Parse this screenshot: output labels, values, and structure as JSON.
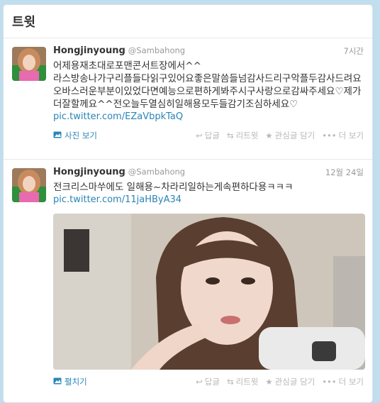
{
  "panel_title": "트윗",
  "tweets": [
    {
      "name": "Hongjinyoung",
      "handle": "@Sambahong",
      "time": "7시간",
      "lines": [
        "어제용재초대로포맨콘서트장에서^^",
        "라스방송나가구리플들다읽구있어요좋은말씀들넘감사드리구악플두감사드려요",
        "오바스러운부분이있었다면예능으로편하게봐주시구사랑으로감싸주세요♡제가더잘할께요^^전오늘두열심히일해용모두들감기조심하세요♡"
      ],
      "link": "pic.twitter.com/EZaVbpkTaQ",
      "expand_label": "사진 보기"
    },
    {
      "name": "Hongjinyoung",
      "handle": "@Sambahong",
      "time": "12월 24일",
      "lines": [
        "전크리스마쑤에도 일해용~차라리일하는게속편하다용ㅋㅋㅋ"
      ],
      "link": "pic.twitter.com/11jaHByA34",
      "expand_label": "펼치기"
    }
  ],
  "actions": {
    "reply": "답글",
    "retweet": "리트윗",
    "favorite": "관심글 담기",
    "more": "더 보기"
  },
  "icons": {
    "photo": "photo-icon",
    "expand": "expand-icon",
    "reply": "reply-icon",
    "retweet": "retweet-icon",
    "favorite": "star-icon",
    "more": "more-dots-icon"
  },
  "colors": {
    "background": "#c0deed",
    "link": "#2a84b7",
    "muted": "#999999"
  }
}
